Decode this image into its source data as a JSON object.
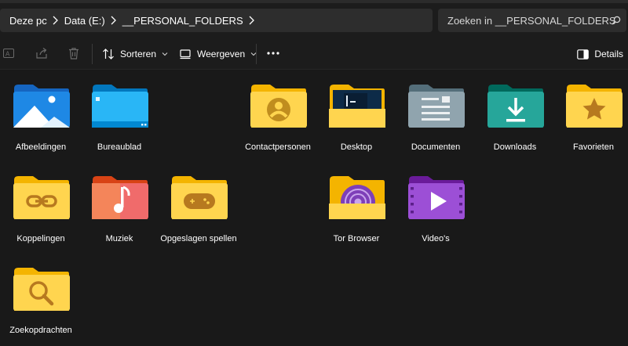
{
  "address": {
    "crumbs": [
      "Deze pc",
      "Data (E:)",
      "__PERSONAL_FOLDERS"
    ]
  },
  "search": {
    "placeholder": "Zoeken in __PERSONAL_FOLDERS"
  },
  "toolbar": {
    "sort_label": "Sorteren",
    "view_label": "Weergeven",
    "details_label": "Details"
  },
  "folders": [
    {
      "label": "Afbeeldingen",
      "icon": "pictures-folder-icon"
    },
    {
      "label": "Bureaublad",
      "icon": "desktop-blue-folder-icon"
    },
    {
      "label": "Contactpersonen",
      "icon": "contacts-folder-icon"
    },
    {
      "label": "Desktop",
      "icon": "desktop-folder-icon"
    },
    {
      "label": "Documenten",
      "icon": "documents-folder-icon"
    },
    {
      "label": "Downloads",
      "icon": "downloads-folder-icon"
    },
    {
      "label": "Favorieten",
      "icon": "favorites-folder-icon"
    },
    {
      "label": "Koppelingen",
      "icon": "links-folder-icon"
    },
    {
      "label": "Muziek",
      "icon": "music-folder-icon"
    },
    {
      "label": "Opgeslagen spellen",
      "icon": "saved-games-folder-icon"
    },
    {
      "label": "Tor Browser",
      "icon": "tor-browser-folder-icon"
    },
    {
      "label": "Video's",
      "icon": "videos-folder-icon"
    },
    {
      "label": "Zoekopdrachten",
      "icon": "searches-folder-icon"
    }
  ]
}
